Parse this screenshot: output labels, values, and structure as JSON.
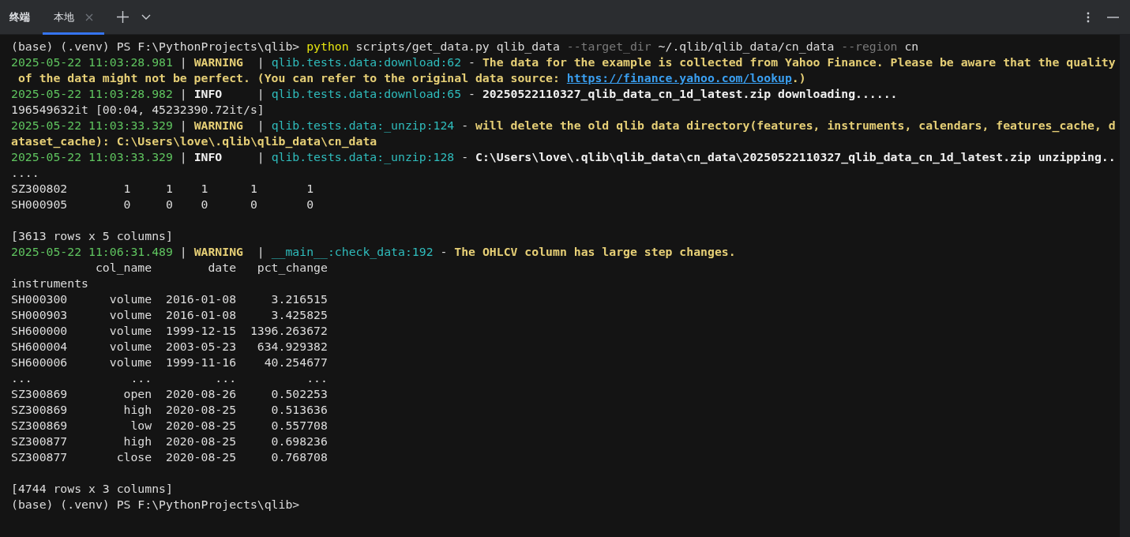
{
  "tool_window": {
    "title": "终端",
    "tabs": [
      {
        "label": "本地",
        "selected": true
      }
    ]
  },
  "terminal": {
    "lines": [
      {
        "kind": "text",
        "segments": [
          {
            "kind": "plain",
            "text": "(base) (.venv) PS F:\\PythonProjects\\qlib> "
          },
          {
            "kind": "command",
            "text": "python"
          },
          {
            "kind": "plain",
            "text": " scripts/get_data.py qlib_data "
          },
          {
            "kind": "option",
            "text": "--target_dir"
          },
          {
            "kind": "plain",
            "text": " ~/.qlib/qlib_data/cn_data "
          },
          {
            "kind": "option",
            "text": "--region"
          },
          {
            "kind": "plain",
            "text": " cn"
          }
        ]
      },
      {
        "kind": "text",
        "segments": [
          {
            "kind": "timestamp",
            "text": "2025-05-22 11:03:28.981"
          },
          {
            "kind": "plain",
            "text": " | "
          },
          {
            "kind": "warning",
            "text": "WARNING"
          },
          {
            "kind": "plain",
            "text": "  | "
          },
          {
            "kind": "module",
            "text": "qlib.tests.data:download:62"
          },
          {
            "kind": "plain",
            "text": " - "
          },
          {
            "kind": "warning",
            "text": "The data for the example is collected from Yahoo Finance. Please be aware that the quality"
          }
        ]
      },
      {
        "kind": "text",
        "segments": [
          {
            "kind": "warning",
            "text": " of the data might not be perfect. (You can refer to the original data source: "
          },
          {
            "kind": "link",
            "text": "https://finance.yahoo.com/lookup"
          },
          {
            "kind": "warning",
            "text": ".)"
          }
        ]
      },
      {
        "kind": "text",
        "segments": [
          {
            "kind": "timestamp",
            "text": "2025-05-22 11:03:28.982"
          },
          {
            "kind": "plain",
            "text": " | "
          },
          {
            "kind": "strong",
            "text": "INFO"
          },
          {
            "kind": "plain",
            "text": "     | "
          },
          {
            "kind": "module",
            "text": "qlib.tests.data:download:65"
          },
          {
            "kind": "plain",
            "text": " - "
          },
          {
            "kind": "strong",
            "text": "20250522110327_qlib_data_cn_1d_latest.zip downloading......"
          }
        ]
      },
      {
        "kind": "text",
        "segments": [
          {
            "kind": "plain",
            "text": "196549632it [00:04, 45232390.72it/s]"
          }
        ]
      },
      {
        "kind": "text",
        "segments": [
          {
            "kind": "timestamp",
            "text": "2025-05-22 11:03:33.329"
          },
          {
            "kind": "plain",
            "text": " | "
          },
          {
            "kind": "warning",
            "text": "WARNING"
          },
          {
            "kind": "plain",
            "text": "  | "
          },
          {
            "kind": "module",
            "text": "qlib.tests.data:_unzip:124"
          },
          {
            "kind": "plain",
            "text": " - "
          },
          {
            "kind": "warning",
            "text": "will delete the old qlib data directory(features, instruments, calendars, features_cache, d"
          }
        ]
      },
      {
        "kind": "text",
        "segments": [
          {
            "kind": "warning",
            "text": "ataset_cache): C:\\Users\\love\\.qlib\\qlib_data\\cn_data"
          }
        ]
      },
      {
        "kind": "text",
        "segments": [
          {
            "kind": "timestamp",
            "text": "2025-05-22 11:03:33.329"
          },
          {
            "kind": "plain",
            "text": " | "
          },
          {
            "kind": "strong",
            "text": "INFO"
          },
          {
            "kind": "plain",
            "text": "     | "
          },
          {
            "kind": "module",
            "text": "qlib.tests.data:_unzip:128"
          },
          {
            "kind": "plain",
            "text": " - "
          },
          {
            "kind": "strong",
            "text": "C:\\Users\\love\\.qlib\\qlib_data\\cn_data\\20250522110327_qlib_data_cn_1d_latest.zip unzipping.."
          }
        ]
      },
      {
        "kind": "text",
        "segments": [
          {
            "kind": "plain",
            "text": "...."
          }
        ]
      },
      {
        "kind": "text",
        "segments": [
          {
            "kind": "plain",
            "text": "SZ300802        1     1    1      1       1"
          }
        ]
      },
      {
        "kind": "text",
        "segments": [
          {
            "kind": "plain",
            "text": "SH000905        0     0    0      0       0"
          }
        ]
      },
      {
        "kind": "blank"
      },
      {
        "kind": "text",
        "segments": [
          {
            "kind": "plain",
            "text": "[3613 rows x 5 columns]"
          }
        ]
      },
      {
        "kind": "text",
        "segments": [
          {
            "kind": "timestamp",
            "text": "2025-05-22 11:06:31.489"
          },
          {
            "kind": "plain",
            "text": " | "
          },
          {
            "kind": "warning",
            "text": "WARNING"
          },
          {
            "kind": "plain",
            "text": "  | "
          },
          {
            "kind": "module",
            "text": "__main__:check_data:192"
          },
          {
            "kind": "plain",
            "text": " - "
          },
          {
            "kind": "warning",
            "text": "The OHLCV column has large step changes."
          }
        ]
      },
      {
        "kind": "text",
        "segments": [
          {
            "kind": "plain",
            "text": "            col_name        date   pct_change"
          }
        ]
      },
      {
        "kind": "text",
        "segments": [
          {
            "kind": "plain",
            "text": "instruments"
          }
        ]
      },
      {
        "kind": "text",
        "segments": [
          {
            "kind": "plain",
            "text": "SH000300      volume  2016-01-08     3.216515"
          }
        ]
      },
      {
        "kind": "text",
        "segments": [
          {
            "kind": "plain",
            "text": "SH000903      volume  2016-01-08     3.425825"
          }
        ]
      },
      {
        "kind": "text",
        "segments": [
          {
            "kind": "plain",
            "text": "SH600000      volume  1999-12-15  1396.263672"
          }
        ]
      },
      {
        "kind": "text",
        "segments": [
          {
            "kind": "plain",
            "text": "SH600004      volume  2003-05-23   634.929382"
          }
        ]
      },
      {
        "kind": "text",
        "segments": [
          {
            "kind": "plain",
            "text": "SH600006      volume  1999-11-16    40.254677"
          }
        ]
      },
      {
        "kind": "text",
        "segments": [
          {
            "kind": "plain",
            "text": "...              ...         ...          ..."
          }
        ]
      },
      {
        "kind": "text",
        "segments": [
          {
            "kind": "plain",
            "text": "SZ300869        open  2020-08-26     0.502253"
          }
        ]
      },
      {
        "kind": "text",
        "segments": [
          {
            "kind": "plain",
            "text": "SZ300869        high  2020-08-25     0.513636"
          }
        ]
      },
      {
        "kind": "text",
        "segments": [
          {
            "kind": "plain",
            "text": "SZ300869         low  2020-08-25     0.557708"
          }
        ]
      },
      {
        "kind": "text",
        "segments": [
          {
            "kind": "plain",
            "text": "SZ300877        high  2020-08-25     0.698236"
          }
        ]
      },
      {
        "kind": "text",
        "segments": [
          {
            "kind": "plain",
            "text": "SZ300877       close  2020-08-25     0.768708"
          }
        ]
      },
      {
        "kind": "blank"
      },
      {
        "kind": "text",
        "segments": [
          {
            "kind": "plain",
            "text": "[4744 rows x 3 columns]"
          }
        ]
      },
      {
        "kind": "text",
        "segments": [
          {
            "kind": "plain",
            "text": "(base) (.venv) PS F:\\PythonProjects\\qlib>"
          }
        ]
      }
    ]
  }
}
